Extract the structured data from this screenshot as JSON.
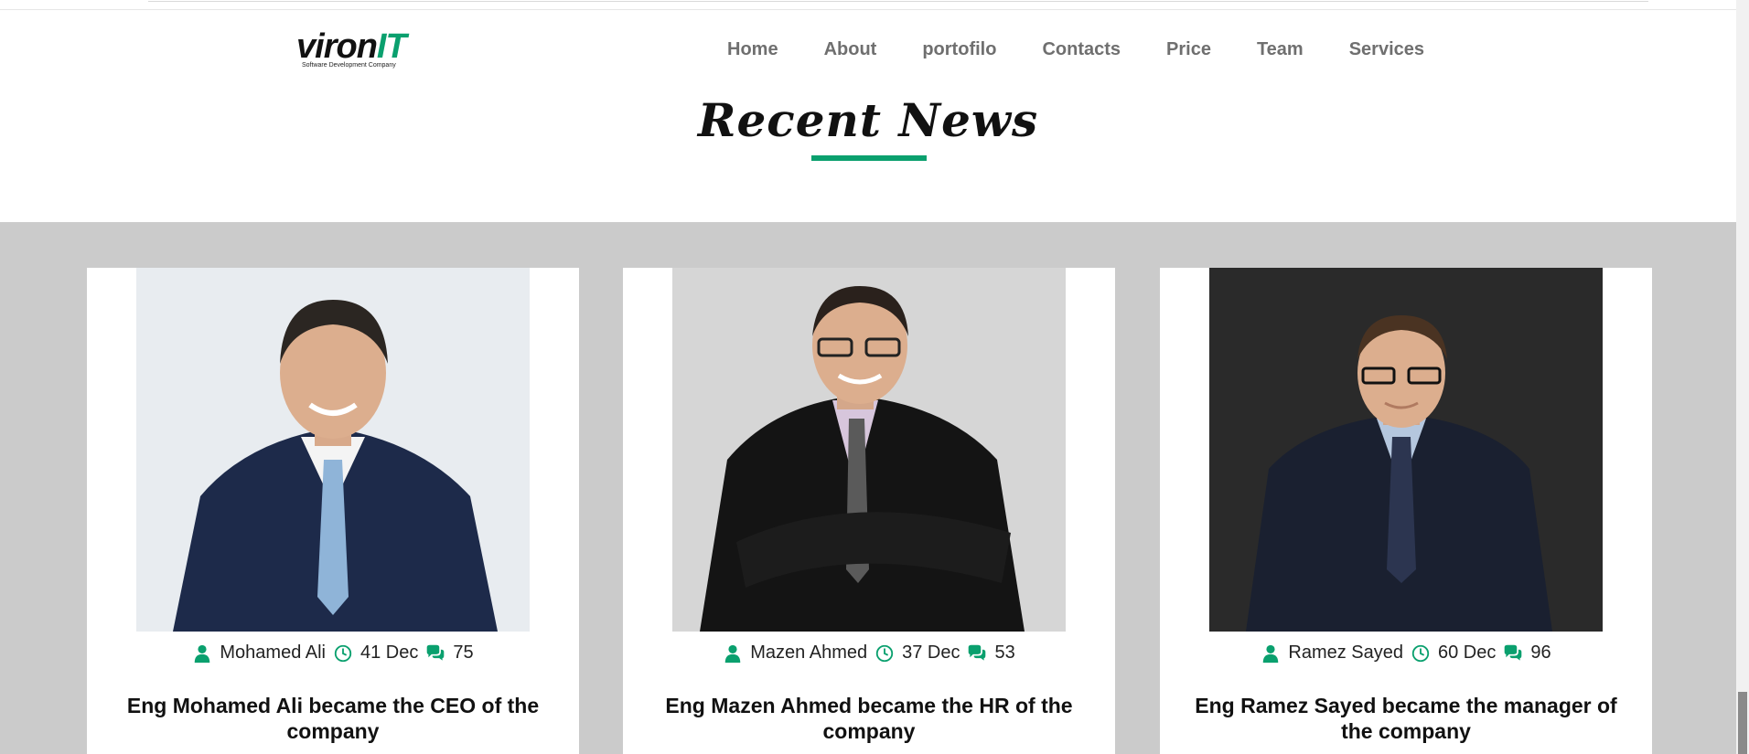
{
  "brand": {
    "name_main": "viron",
    "name_accent": "IT",
    "tagline": "Software Development Company",
    "accent_color": "#0aa06e"
  },
  "nav": {
    "items": [
      "Home",
      "About",
      "portofilo",
      "Contacts",
      "Price",
      "Team",
      "Services"
    ]
  },
  "section": {
    "title": "Recent News",
    "background": "#cbcbcb"
  },
  "cards": [
    {
      "author": "Mohamed Ali",
      "date": "41 Dec",
      "comments": "75",
      "title": "Eng Mohamed Ali became the CEO of the company",
      "photo_bg": "#e8ecf0",
      "suit": "#1d2a4a",
      "tie": "#8fb4d8"
    },
    {
      "author": "Mazen Ahmed",
      "date": "37 Dec",
      "comments": "53",
      "title": "Eng Mazen Ahmed became the HR of the company",
      "photo_bg": "#d6d6d6",
      "suit": "#141414",
      "tie": "#5a5a5a"
    },
    {
      "author": "Ramez Sayed",
      "date": "60 Dec",
      "comments": "96",
      "title": "Eng Ramez Sayed became the manager of the company",
      "photo_bg": "#2a2a2a",
      "suit": "#1a2030",
      "tie": "#2c3550"
    }
  ],
  "icons": {
    "author": "user-icon",
    "date": "clock-icon",
    "comments": "comments-icon"
  }
}
